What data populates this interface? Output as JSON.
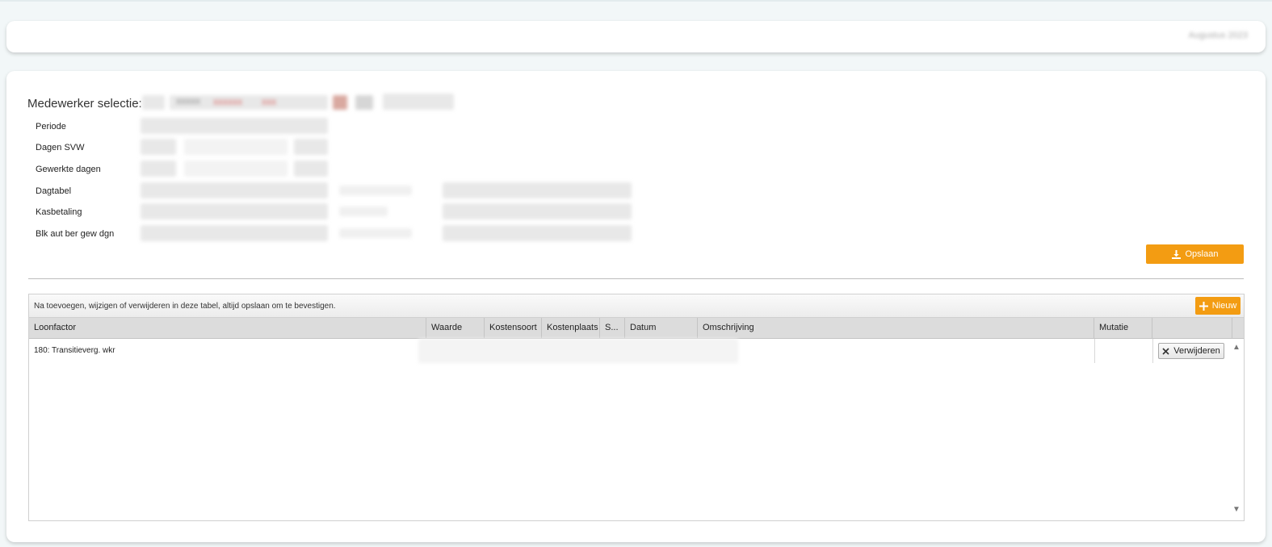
{
  "header": {
    "right_text": "Augustus 2023"
  },
  "selection": {
    "title": "Medewerker selectie:",
    "labels": [
      "Periode",
      "Dagen SVW",
      "Gewerkte dagen",
      "Dagtabel",
      "Kasbetaling",
      "Blk aut ber gew dgn"
    ]
  },
  "actions": {
    "save_label": "Opslaan"
  },
  "grid": {
    "info": "Na toevoegen, wijzigen of verwijderen in deze tabel, altijd opslaan om te bevestigen.",
    "new_label": "Nieuw",
    "columns": [
      "Loonfactor",
      "Waarde",
      "Kostensoort",
      "Kostenplaats",
      "S...",
      "Datum",
      "Omschrijving",
      "Mutatie",
      ""
    ],
    "rows": [
      {
        "loonfactor": "180: Transitieverg. wkr",
        "delete_label": "Verwijderen"
      }
    ]
  },
  "colors": {
    "accent": "#f39c12",
    "background": "#f2f7f8"
  },
  "icons": {
    "save": "download-icon",
    "new": "plus-icon",
    "delete": "close-icon"
  }
}
